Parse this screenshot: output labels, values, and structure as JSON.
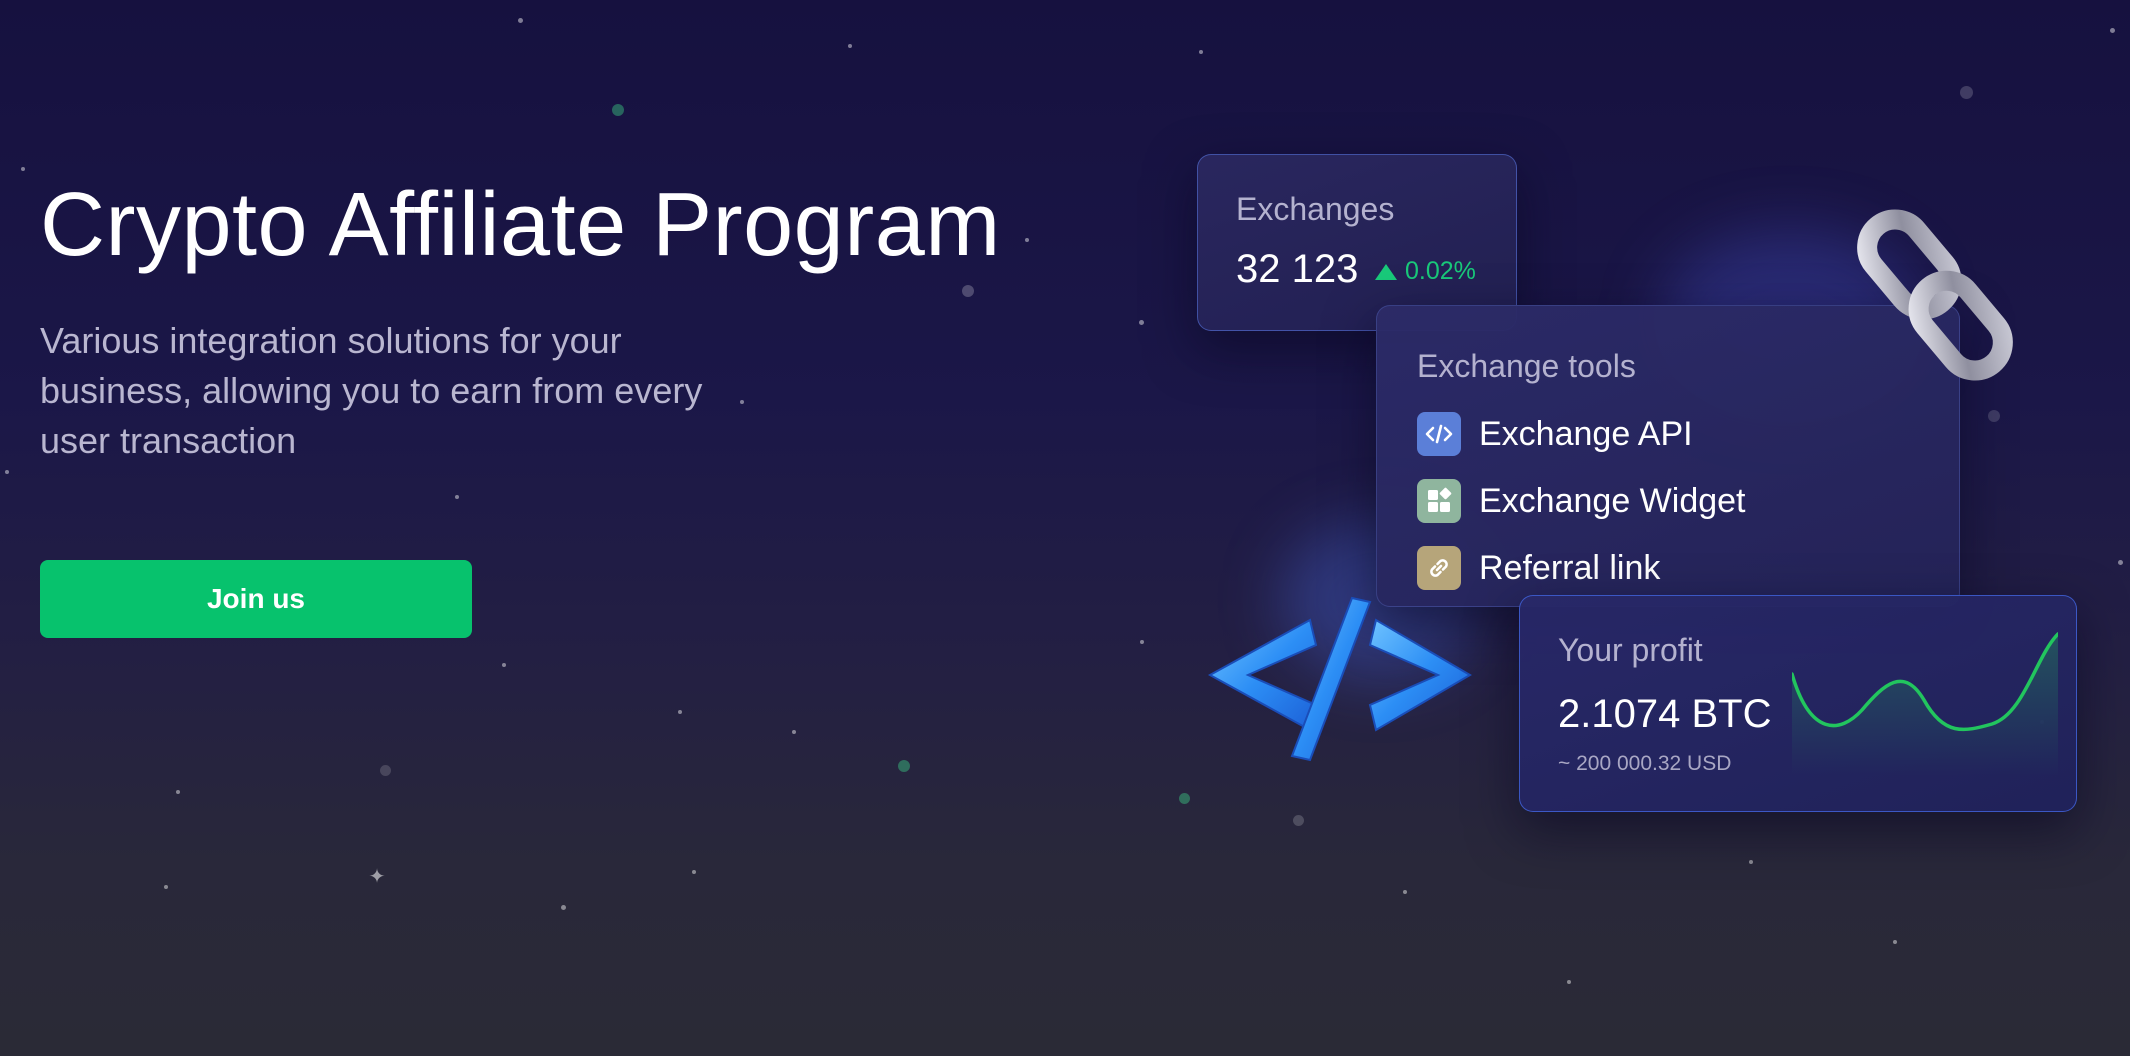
{
  "hero": {
    "title": "Crypto Affiliate Program",
    "subtitle": "Various integration solutions for your business, allowing you to earn from every user transaction",
    "cta_label": "Join us"
  },
  "exchanges_card": {
    "label": "Exchanges",
    "value": "32 123",
    "change": "0.02%",
    "change_color": "#19c97a"
  },
  "tools_card": {
    "label": "Exchange tools",
    "items": [
      {
        "label": "Exchange API",
        "icon": "code-icon",
        "color": "#5b7fd8"
      },
      {
        "label": "Exchange Widget",
        "icon": "widget-icon",
        "color": "#8fb59e"
      },
      {
        "label": "Referral link",
        "icon": "link-icon",
        "color": "#b6a57a"
      }
    ]
  },
  "profit_card": {
    "label": "Your profit",
    "value": "2.1074 BTC",
    "usd": "~ 200 000.32 USD",
    "line_color": "#22c55e"
  },
  "colors": {
    "cta": "#07c26d",
    "background_top": "#16113f",
    "background_bottom": "#2a2a36",
    "card_border": "#5a78e6"
  }
}
